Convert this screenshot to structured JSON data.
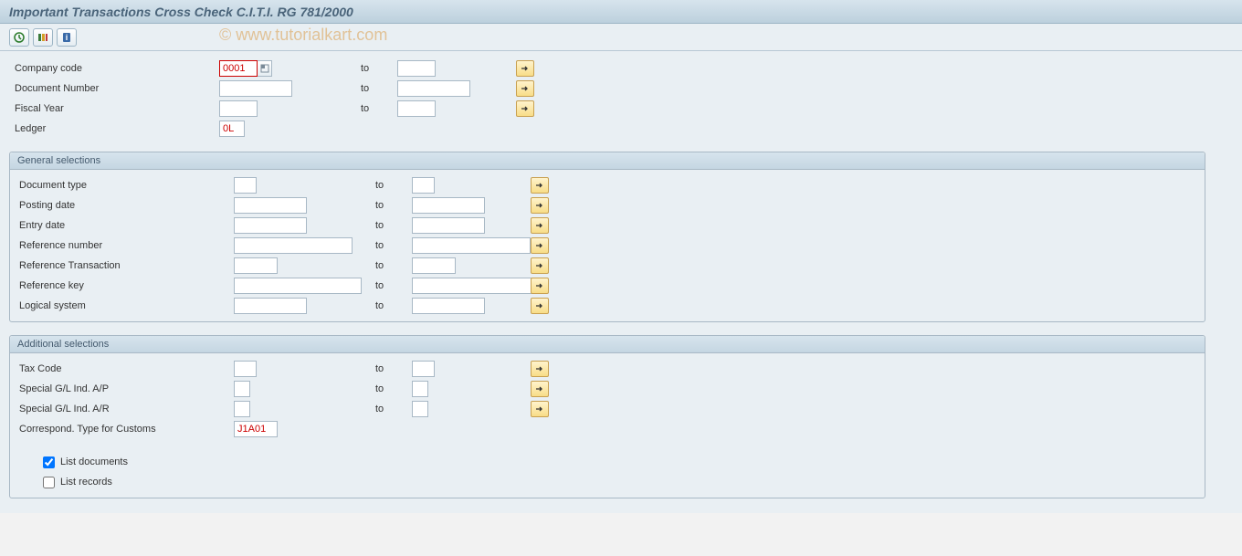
{
  "title": "Important Transactions Cross Check C.I.T.I. RG 781/2000",
  "watermark": "© www.tutorialkart.com",
  "toolbar": {
    "execute_icon": "execute",
    "variant_icon": "variant",
    "info_icon": "info"
  },
  "to_label": "to",
  "top": {
    "company_code": {
      "label": "Company code",
      "value": "0001"
    },
    "doc_number": {
      "label": "Document Number",
      "value": ""
    },
    "fiscal_year": {
      "label": "Fiscal Year",
      "value": ""
    },
    "ledger": {
      "label": "Ledger",
      "value": "0L"
    }
  },
  "group1": {
    "title": "General selections",
    "doc_type": {
      "label": "Document type"
    },
    "posting": {
      "label": "Posting date"
    },
    "entry": {
      "label": "Entry date"
    },
    "refnum": {
      "label": "Reference number"
    },
    "reftran": {
      "label": "Reference Transaction"
    },
    "refkey": {
      "label": "Reference key"
    },
    "logsys": {
      "label": "Logical system"
    }
  },
  "group2": {
    "title": "Additional selections",
    "tax": {
      "label": "Tax Code"
    },
    "sgl_ap": {
      "label": "Special G/L Ind. A/P"
    },
    "sgl_ar": {
      "label": "Special G/L Ind. A/R"
    },
    "corr": {
      "label": "Correspond. Type for Customs",
      "value": "J1A01"
    },
    "list_docs": {
      "label": "List documents",
      "checked": true
    },
    "list_recs": {
      "label": "List records",
      "checked": false
    }
  }
}
